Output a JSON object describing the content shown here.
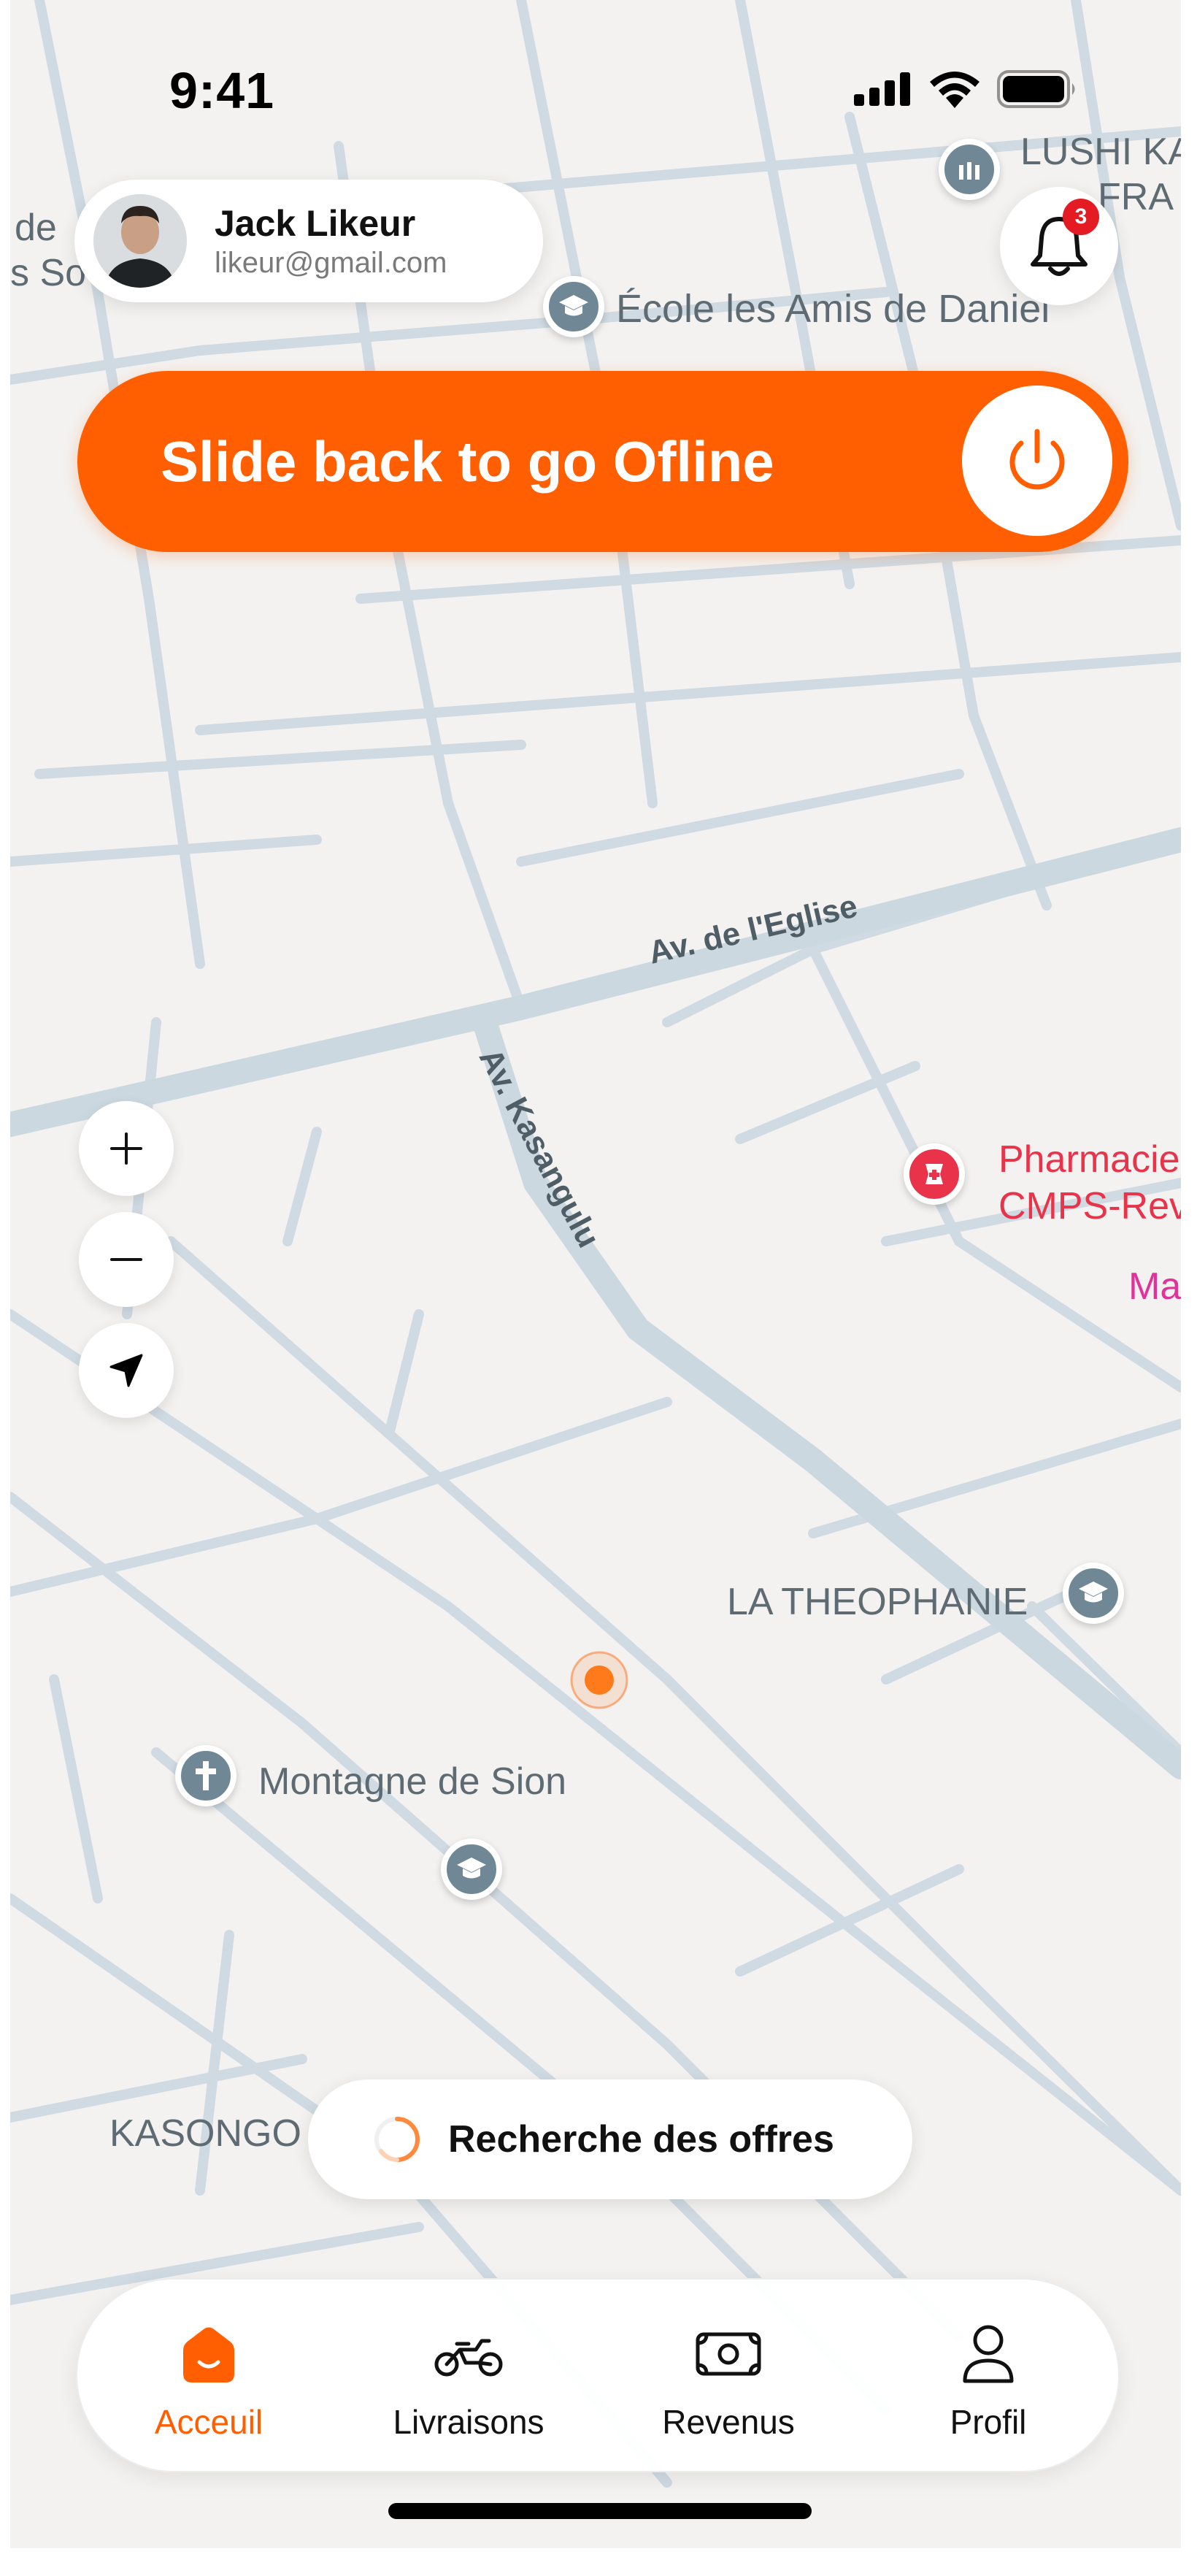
{
  "status_bar": {
    "time": "9:41"
  },
  "user": {
    "name": "Jack Likeur",
    "email": "likeur@gmail.com"
  },
  "notifications": {
    "count": "3"
  },
  "slider": {
    "label": "Slide back to go Ofline"
  },
  "map": {
    "labels": {
      "poi_top_right_1": "LUSHI KA",
      "poi_top_right_2": "FRA",
      "partial_left_1": "de",
      "partial_left_2": "s So",
      "school": "École les Amis de Daniel",
      "street_eglise": "Av. de l'Eglise",
      "street_kasangulu": "Av. Kasangulu",
      "pharmacy_1": "Pharmacie",
      "pharmacy_2": "CMPS-Rev",
      "partial_ma": "Ma",
      "theophanie": "LA THEOPHANIE",
      "montagne": "Montagne de Sion",
      "kasongo": "KASONGO"
    }
  },
  "search": {
    "status": "Recherche des offres"
  },
  "nav": {
    "items": [
      {
        "label": "Acceuil",
        "icon": "home-icon",
        "active": true
      },
      {
        "label": "Livraisons",
        "icon": "motorbike-icon",
        "active": false
      },
      {
        "label": "Revenus",
        "icon": "banknote-icon",
        "active": false
      },
      {
        "label": "Profil",
        "icon": "user-icon",
        "active": false
      }
    ]
  },
  "colors": {
    "accent": "#FF5F00",
    "badge": "#E41B23",
    "pharmacy": "#E8334A",
    "map_bg": "#F3F2F0",
    "road": "#CDD9E1"
  }
}
